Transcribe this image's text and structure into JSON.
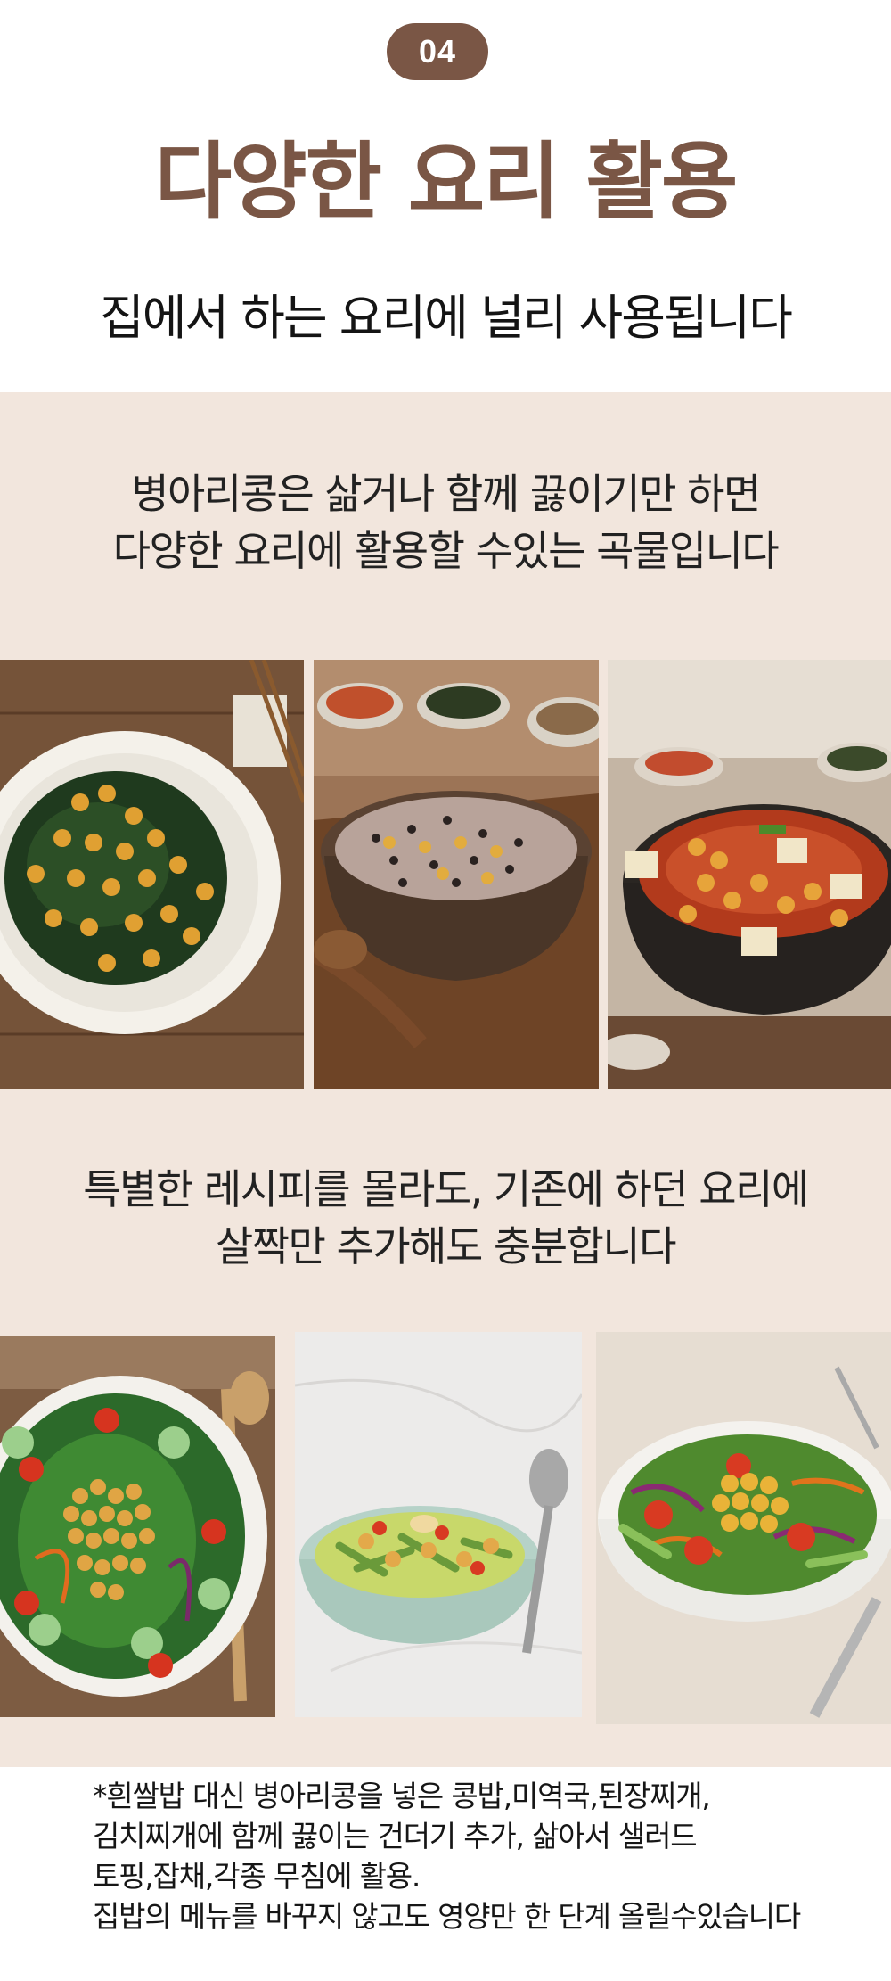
{
  "header": {
    "badge": "04",
    "title": "다양한 요리 활용",
    "subtitle": "집에서 하는 요리에 널리 사용됩니다"
  },
  "section1": {
    "lines": [
      "병아리콩은 삶거나 함께 끓이기만 하면",
      "다양한 요리에 활용할 수있는 곡물입니다"
    ]
  },
  "section2": {
    "lines": [
      "특별한 레시피를 몰라도, 기존에 하던 요리에",
      "살짝만 추가해도 충분합니다"
    ]
  },
  "photos": [
    {
      "name": "spinach-chickpea-salad-photo"
    },
    {
      "name": "multigrain-rice-bowl-photo"
    },
    {
      "name": "kimchi-stew-pot-photo"
    },
    {
      "name": "green-salad-bowl-photo"
    },
    {
      "name": "cucumber-chickpea-bowl-photo"
    },
    {
      "name": "veggie-salad-plate-photo"
    }
  ],
  "note": {
    "lines": [
      "*흰쌀밥 대신 병아리콩을 넣은 콩밥,미역국,된장찌개,",
      "김치찌개에 함께 끓이는 건더기 추가, 삶아서 샐러드",
      "토핑,잡채,각종 무침에 활용.",
      "집밥의 메뉴를 바꾸지 않고도 영양만 한 단계 올릴수있습니다"
    ]
  },
  "colors": {
    "accent": "#7a5645",
    "beige": "#f2e6dd"
  }
}
